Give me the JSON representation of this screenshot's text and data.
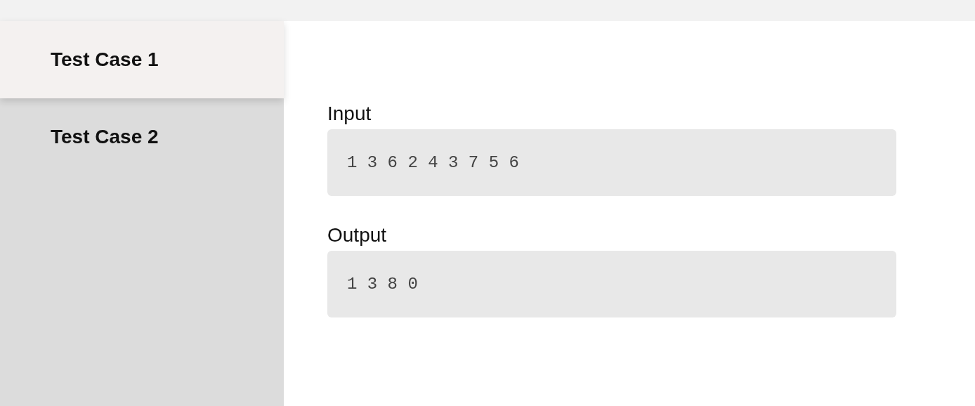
{
  "tabs": [
    {
      "label": "Test Case 1",
      "selected": true
    },
    {
      "label": "Test Case 2",
      "selected": false
    }
  ],
  "sections": [
    {
      "label": "Input",
      "value": "1 3 6 2 4 3 7 5 6"
    },
    {
      "label": "Output",
      "value": "1 3 8 0"
    }
  ]
}
